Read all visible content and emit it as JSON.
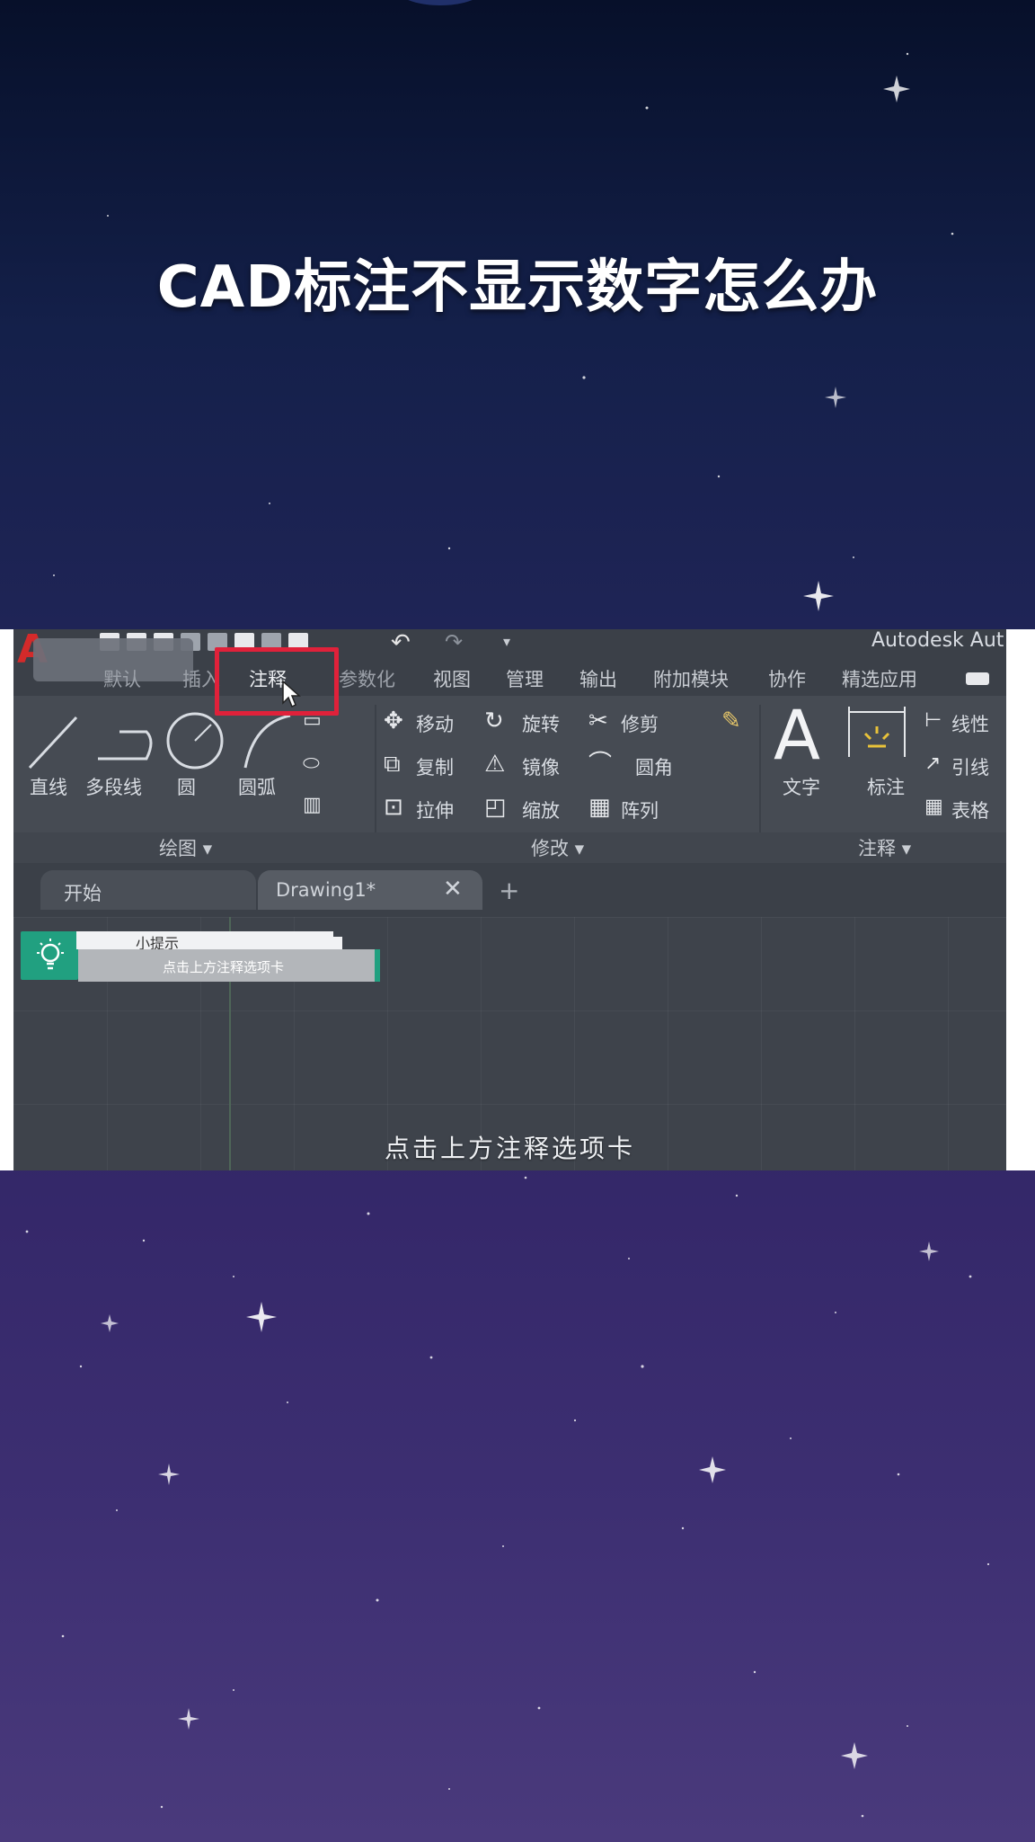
{
  "page": {
    "title": "CAD标注不显示数字怎么办"
  },
  "app": {
    "window_title": "Autodesk Aut",
    "tabs": [
      {
        "label": "默认"
      },
      {
        "label": "插入"
      },
      {
        "label": "注释"
      },
      {
        "label": "参数化"
      },
      {
        "label": "视图"
      },
      {
        "label": "管理"
      },
      {
        "label": "输出"
      },
      {
        "label": "附加模块"
      },
      {
        "label": "协作"
      },
      {
        "label": "精选应用"
      }
    ],
    "ribbon": {
      "draw": {
        "title": "绘图 ▾",
        "tools": [
          "直线",
          "多段线",
          "圆",
          "圆弧"
        ]
      },
      "modify": {
        "title": "修改 ▾",
        "tools": [
          "移动",
          "旋转",
          "修剪",
          "复制",
          "镜像",
          "圆角",
          "拉伸",
          "缩放",
          "阵列"
        ]
      },
      "annotation": {
        "title": "注释 ▾",
        "tools": [
          "文字",
          "标注",
          "线性",
          "引线",
          "表格"
        ]
      }
    },
    "doc_tabs": [
      {
        "label": "开始"
      },
      {
        "label": "Drawing1*"
      }
    ],
    "tip": {
      "title": "小提示",
      "text": "点击上方注释选项卡"
    },
    "caption": "点击上方注释选项卡"
  },
  "colors": {
    "highlight": "#e0213a",
    "tip_accent": "#21a080",
    "logo": "#d42a2a"
  }
}
